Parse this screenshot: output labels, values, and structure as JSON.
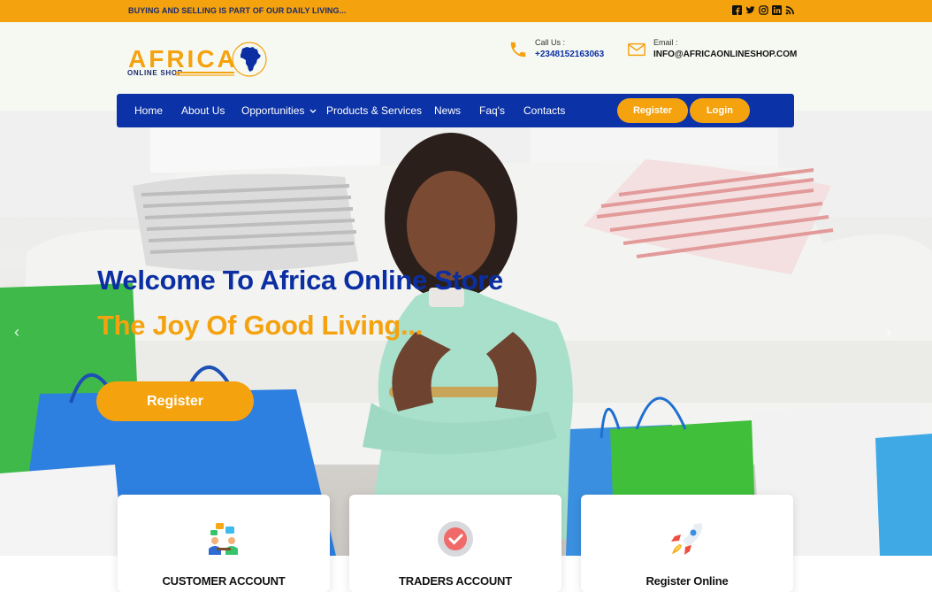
{
  "topbar": {
    "tagline": "BUYING AND SELLING IS PART OF OUR DAILY LIVING...",
    "socials": [
      "facebook-icon",
      "twitter-icon",
      "instagram-icon",
      "linkedin-icon",
      "rss-icon"
    ]
  },
  "header": {
    "logo_word": "AFRICA",
    "logo_sub": "ONLINE SHOP",
    "call_label": "Call Us :",
    "call_value": "+2348152163063",
    "email_label": "Email :",
    "email_value": "INFO@AFRICAONLINESHOP.COM"
  },
  "nav": {
    "items": [
      "Home",
      "About Us",
      "Opportunities",
      "Products & Services",
      "News",
      "Faq's",
      "Contacts"
    ],
    "register_label": "Register",
    "login_label": "Login"
  },
  "hero": {
    "title": "Welcome To Africa Online Store",
    "subtitle": "The Joy Of Good Living...",
    "button_label": "Register",
    "prev_arrow": "‹",
    "next_arrow": "›"
  },
  "cards": [
    {
      "title": "CUSTOMER ACCOUNT",
      "icon": "chat-people-icon"
    },
    {
      "title": "TRADERS ACCOUNT",
      "icon": "checkmark-badge-icon"
    },
    {
      "title": "Register Online",
      "icon": "rocket-icon"
    }
  ],
  "colors": {
    "brand_orange": "#f5a20f",
    "brand_blue": "#0b32a6"
  }
}
